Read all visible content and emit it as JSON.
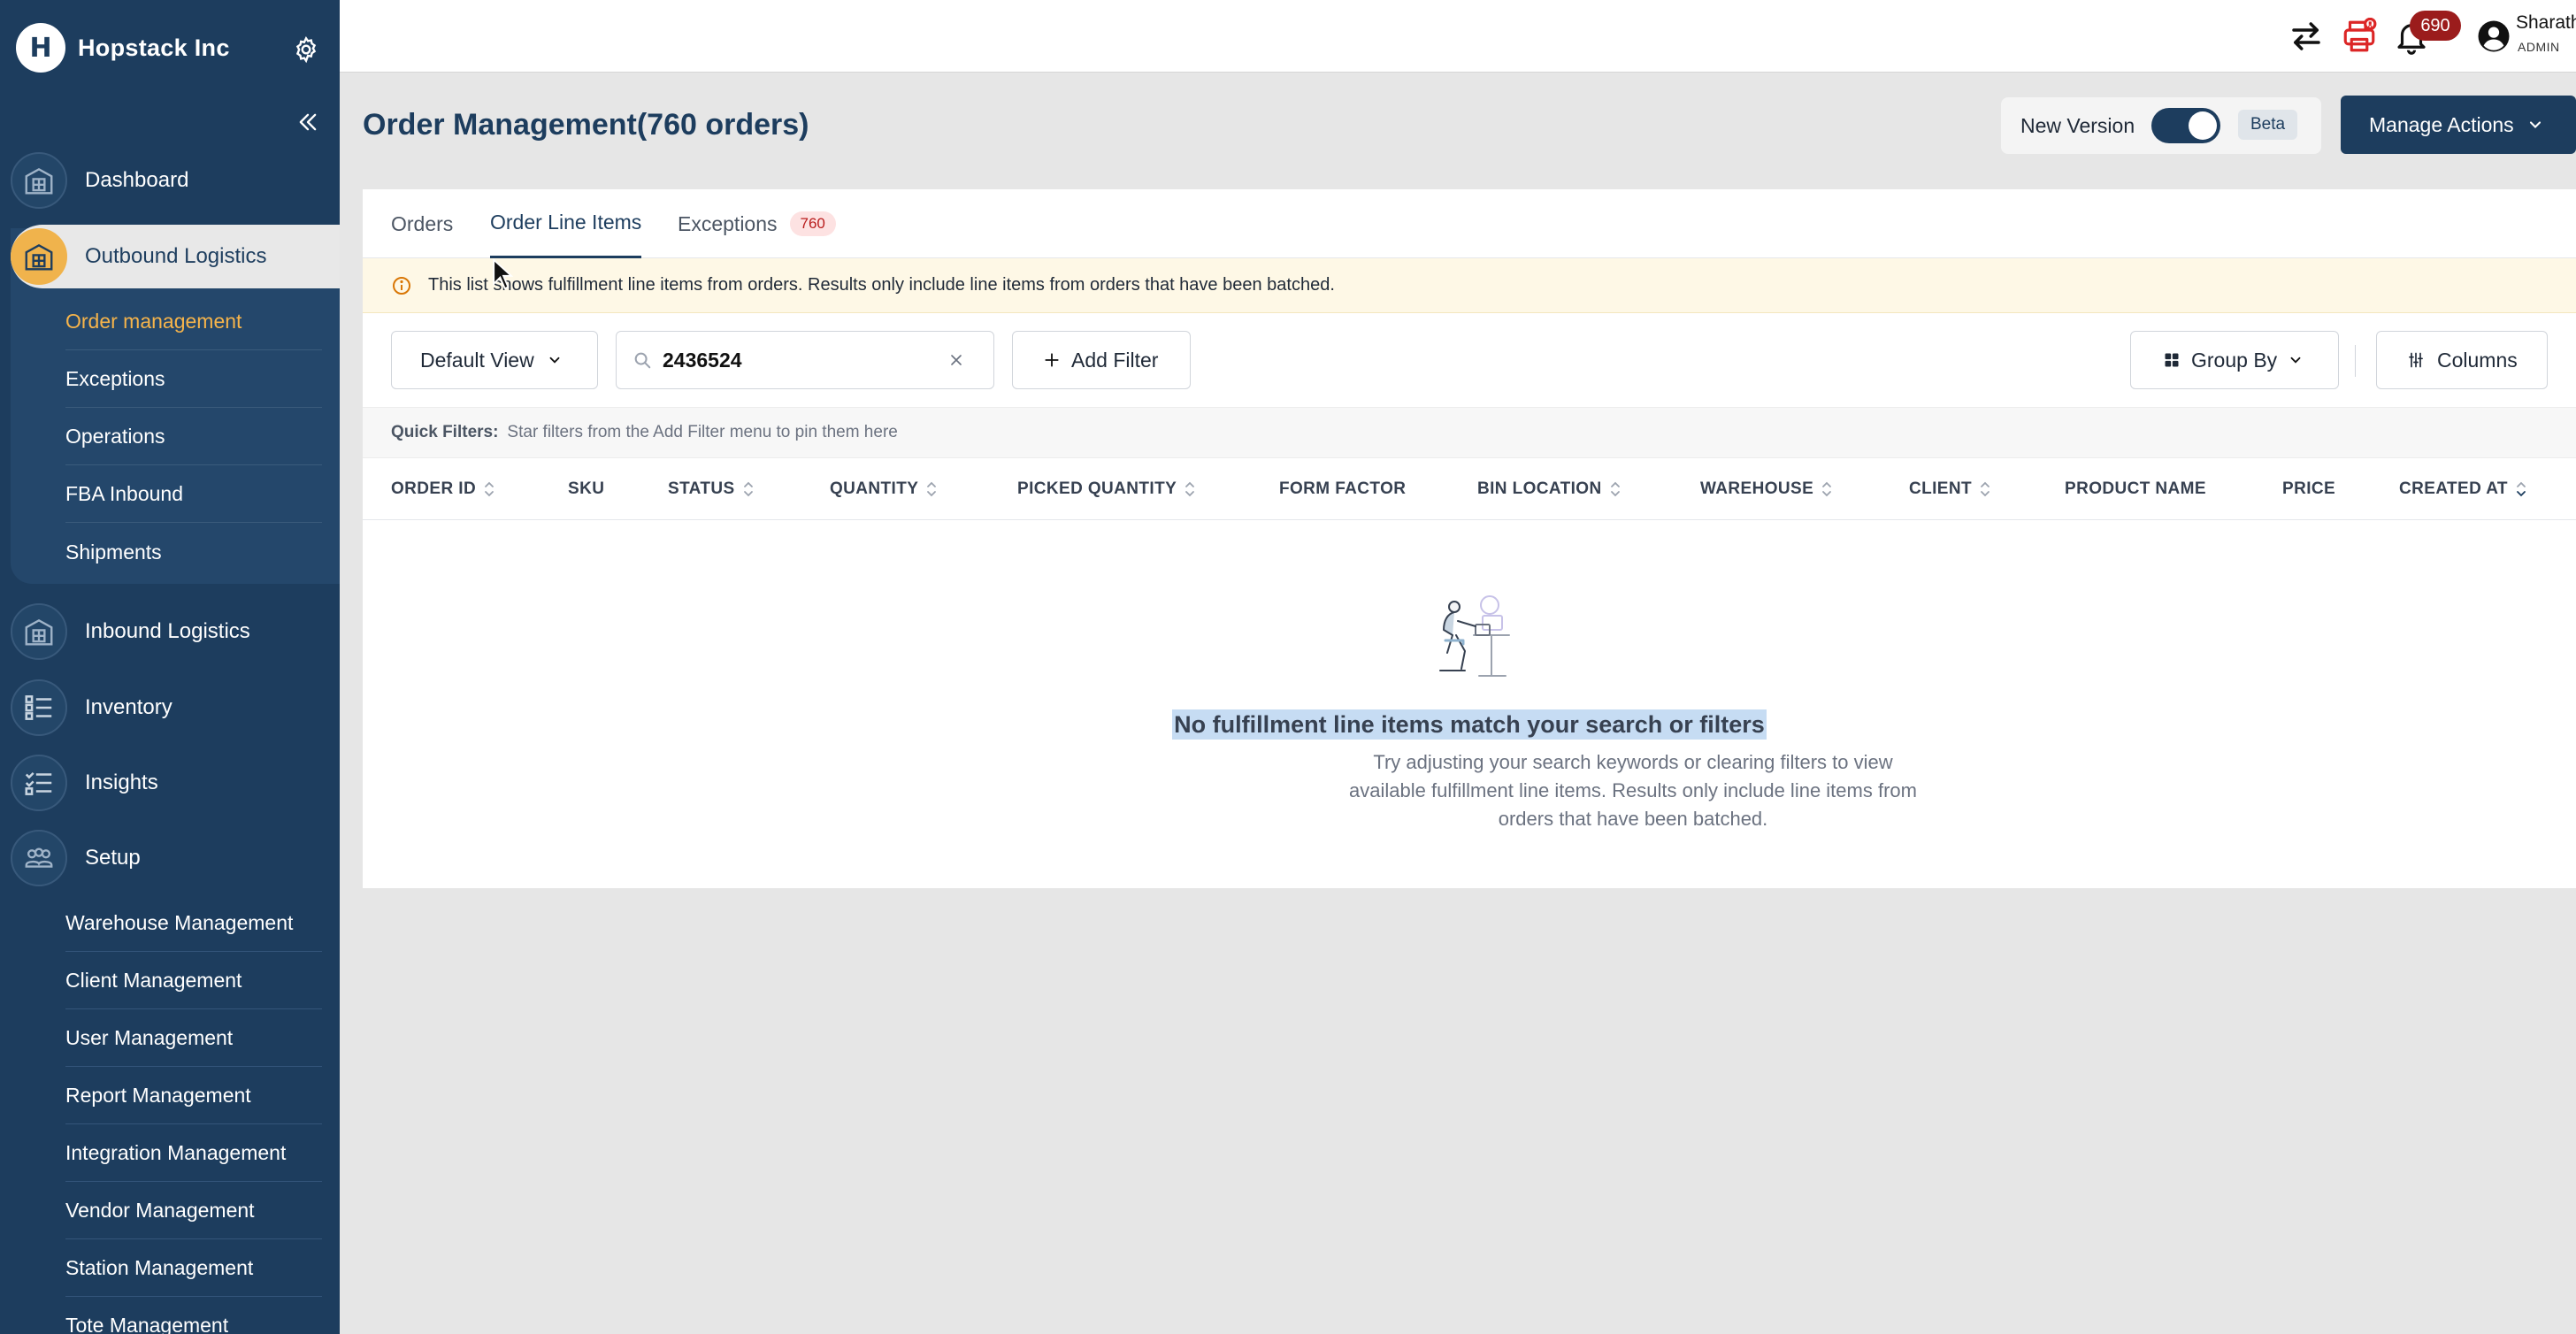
{
  "sidebar": {
    "brand": "Hopstack Inc",
    "brand_logo_letter": "H",
    "items": {
      "dashboard": "Dashboard",
      "outbound": "Outbound Logistics",
      "inbound": "Inbound Logistics",
      "inventory": "Inventory",
      "insights": "Insights",
      "setup": "Setup"
    },
    "outbound_sub": [
      "Order management",
      "Exceptions",
      "Operations",
      "FBA Inbound",
      "Shipments"
    ],
    "setup_sub": [
      "Warehouse Management",
      "Client Management",
      "User Management",
      "Report Management",
      "Integration Management",
      "Vendor Management",
      "Station Management",
      "Tote Management"
    ]
  },
  "topbar": {
    "notification_count": "690",
    "user_name": "Sharath",
    "user_role": "ADMIN"
  },
  "header": {
    "title": "Order Management(760 orders)",
    "version_label": "New Version",
    "beta_label": "Beta",
    "manage_label": "Manage Actions"
  },
  "tabs": {
    "orders": "Orders",
    "line_items": "Order Line Items",
    "exceptions": "Exceptions",
    "exceptions_count": "760"
  },
  "banner": {
    "text": "This list shows fulfillment line items from orders. Results only include line items from orders that have been batched."
  },
  "controls": {
    "view_label": "Default View",
    "search_value": "2436524",
    "add_filter_label": "Add Filter",
    "group_by_label": "Group By",
    "columns_label": "Columns"
  },
  "quick_filters": {
    "label": "Quick Filters:",
    "hint": "Star filters from the Add Filter menu to pin them here"
  },
  "table": {
    "columns": [
      "ORDER ID",
      "SKU",
      "STATUS",
      "QUANTITY",
      "PICKED QUANTITY",
      "FORM FACTOR",
      "BIN LOCATION",
      "WAREHOUSE",
      "CLIENT",
      "PRODUCT NAME",
      "PRICE",
      "CREATED AT"
    ]
  },
  "empty_state": {
    "title": "No fulfillment line items match your search or filters",
    "description": "Try adjusting your search keywords or clearing filters to view available fulfillment line items. Results only include line items from orders that have been batched."
  },
  "colors": {
    "sidebar_bg": "#1d3d5e",
    "accent": "#f6b44b",
    "primary": "#1d3d5e",
    "badge_red": "#9b1c1c"
  }
}
